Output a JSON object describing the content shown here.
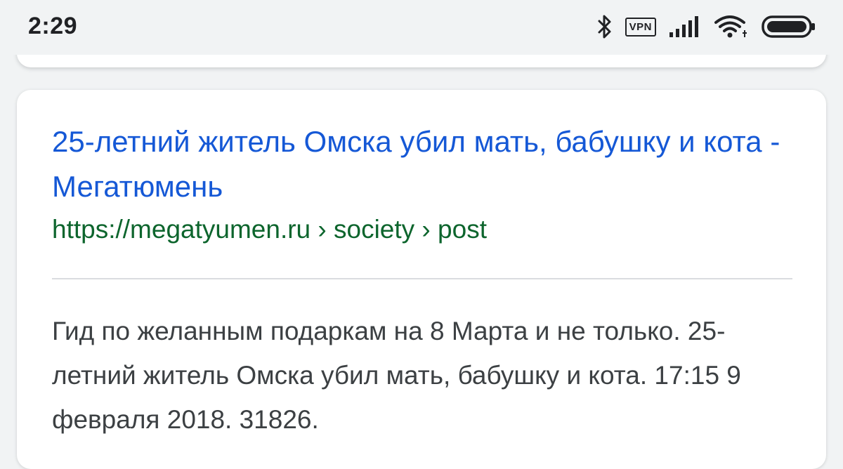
{
  "status_bar": {
    "time": "2:29",
    "vpn_label": "VPN",
    "icons": [
      "bluetooth-icon",
      "vpn-icon",
      "signal-icon",
      "wifi-icon",
      "battery-icon"
    ]
  },
  "result": {
    "title": "25-летний житель Омска убил мать, бабушку и кота - Мегатюмень",
    "url": "https://megatyumen.ru › society › post",
    "snippet": "Гид по желанным подаркам на 8 Марта и не только. 25-летний житель Омска убил мать, бабушку и кота. 17:15 9 февраля 2018. 31826."
  },
  "colors": {
    "title_link": "#1558d6",
    "url": "#0d652d",
    "snippet_text": "#3c4043",
    "background": "#f1f3f4",
    "card": "#ffffff"
  }
}
